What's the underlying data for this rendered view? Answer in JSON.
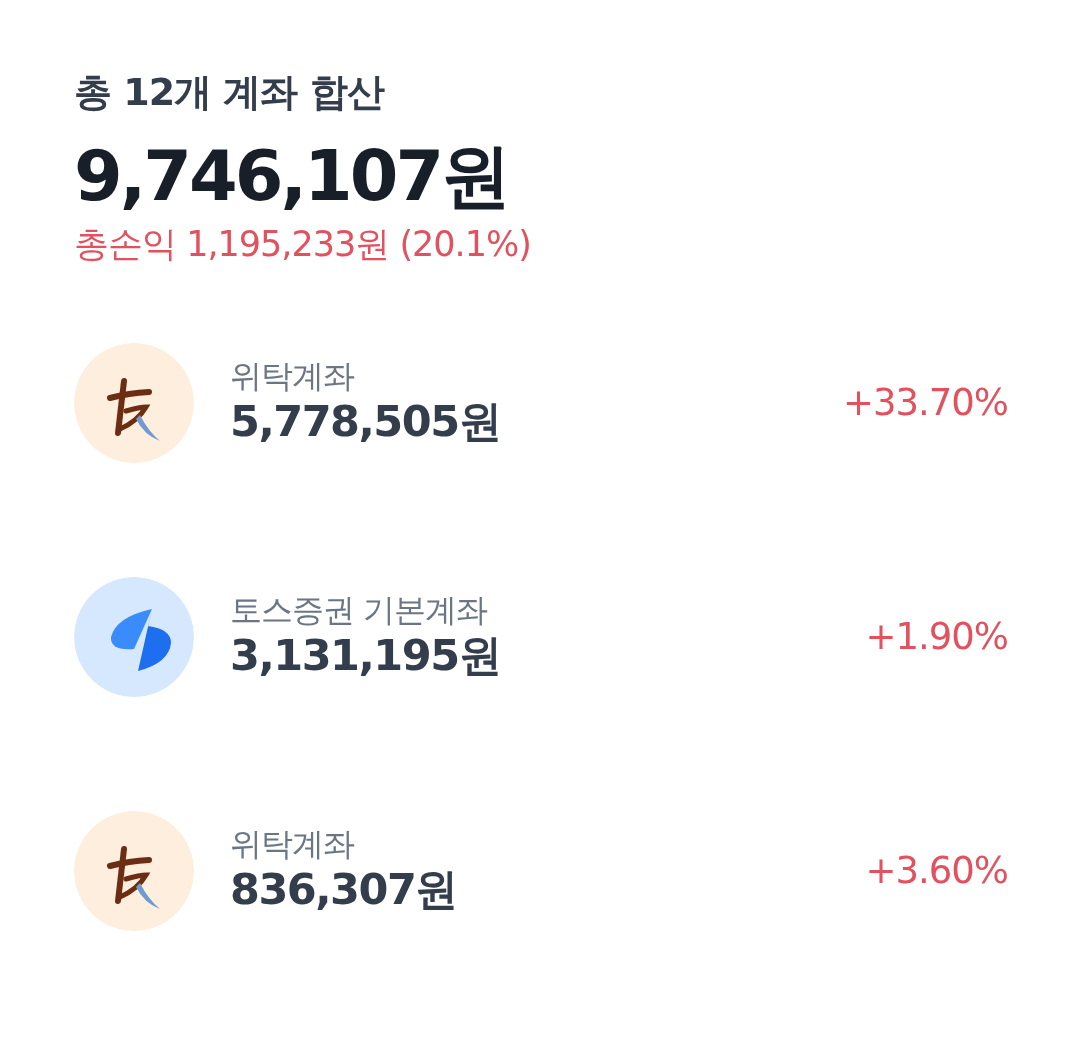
{
  "summary": {
    "title": "총 12개 계좌 합산",
    "total": "9,746,107원",
    "profit": "총손익 1,195,233원 (20.1%)"
  },
  "accounts": [
    {
      "kind": "brush",
      "name": "위탁계좌",
      "amount": "5,778,505원",
      "change": "+33.70%"
    },
    {
      "kind": "blue",
      "name": "토스증권 기본계좌",
      "amount": "3,131,195원",
      "change": "+1.90%"
    },
    {
      "kind": "brush",
      "name": "위탁계좌",
      "amount": "836,307원",
      "change": "+3.60%"
    }
  ]
}
